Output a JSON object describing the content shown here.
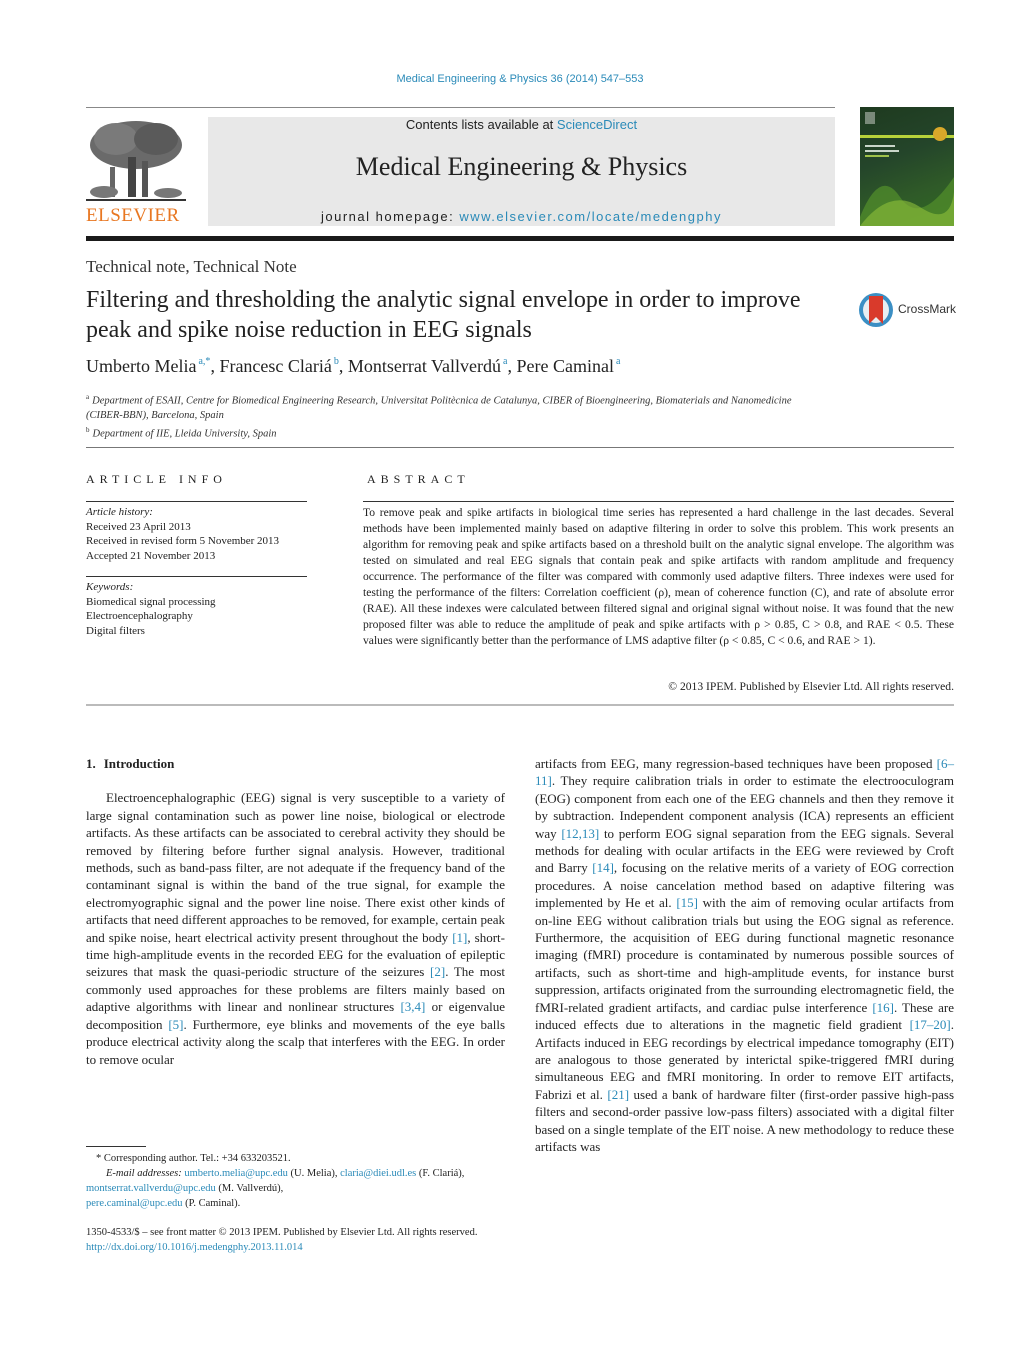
{
  "header": {
    "citation": "Medical Engineering & Physics 36 (2014) 547–553",
    "publisher_logo_text": "ELSEVIER",
    "contents_prefix": "Contents lists available at ",
    "contents_link": "ScienceDirect",
    "journal_name": "Medical Engineering & Physics",
    "homepage_prefix": "journal homepage: ",
    "homepage_link": "www.elsevier.com/locate/medengphy",
    "brand_color": "#e87722",
    "link_color": "#2a8ab8"
  },
  "article": {
    "type": "Technical note, Technical Note",
    "title": "Filtering and thresholding the analytic signal envelope in order to improve peak and spike noise reduction in EEG signals",
    "crossmark_label": "CrossMark",
    "authors": [
      {
        "name": "Umberto Melia",
        "sup": "a,*"
      },
      {
        "name": "Francesc Clariá",
        "sup": "b"
      },
      {
        "name": "Montserrat Vallverdú",
        "sup": "a"
      },
      {
        "name": "Pere Caminal",
        "sup": "a"
      }
    ],
    "affiliations": [
      {
        "label": "a",
        "text": "Department of ESAII, Centre for Biomedical Engineering Research, Universitat Politècnica de Catalunya, CIBER of Bioengineering, Biomaterials and Nanomedicine (CIBER-BBN), Barcelona, Spain"
      },
      {
        "label": "b",
        "text": "Department of IIE, Lleida University, Spain"
      }
    ]
  },
  "article_info": {
    "heading": "ARTICLE INFO",
    "history_label": "Article history:",
    "history": [
      "Received 23 April 2013",
      "Received in revised form 5 November 2013",
      "Accepted 21 November 2013"
    ],
    "keywords_label": "Keywords:",
    "keywords": [
      "Biomedical signal processing",
      "Electroencephalography",
      "Digital filters"
    ]
  },
  "abstract": {
    "heading": "ABSTRACT",
    "text": "To remove peak and spike artifacts in biological time series has represented a hard challenge in the last decades. Several methods have been implemented mainly based on adaptive filtering in order to solve this problem. This work presents an algorithm for removing peak and spike artifacts based on a threshold built on the analytic signal envelope. The algorithm was tested on simulated and real EEG signals that contain peak and spike artifacts with random amplitude and frequency occurrence. The performance of the filter was compared with commonly used adaptive filters. Three indexes were used for testing the performance of the filters: Correlation coefficient (ρ), mean of coherence function (C), and rate of absolute error (RAE). All these indexes were calculated between filtered signal and original signal without noise. It was found that the new proposed filter was able to reduce the amplitude of peak and spike artifacts with ρ > 0.85, C > 0.8, and RAE < 0.5. These values were significantly better than the performance of LMS adaptive filter (ρ < 0.85, C < 0.6, and RAE > 1).",
    "copyright": "© 2013 IPEM. Published by Elsevier Ltd. All rights reserved."
  },
  "body": {
    "section_number": "1.",
    "section_title": "Introduction",
    "left_column": [
      {
        "t": "Electroencephalographic (EEG) signal is very susceptible to a variety of large signal contamination such as power line noise, biological or electrode artifacts. As these artifacts can be associated to cerebral activity they should be removed by filtering before further signal analysis. However, traditional methods, such as band-pass filter, are not adequate if the frequency band of the contaminant signal is within the band of the true signal, for example the electromyographic signal and the power line noise. There exist other kinds of artifacts that need different approaches to be removed, for example, certain peak and spike noise, heart electrical activity present throughout the body "
      },
      {
        "ref": "[1]"
      },
      {
        "t": ", short-time high-amplitude events in the recorded EEG for the evaluation of epileptic seizures that mask the quasi-periodic structure of the seizures "
      },
      {
        "ref": "[2]"
      },
      {
        "t": ". The most commonly used approaches for these problems are filters mainly based on adaptive algorithms with linear and nonlinear structures "
      },
      {
        "ref": "[3,4]"
      },
      {
        "t": " or eigenvalue decomposition "
      },
      {
        "ref": "[5]"
      },
      {
        "t": ". Furthermore, eye blinks and movements of the eye balls produce electrical activity along the scalp that interferes with the EEG. In order to remove ocular"
      }
    ],
    "right_column": [
      {
        "t": "artifacts from EEG, many regression-based techniques have been proposed "
      },
      {
        "ref": "[6–11]"
      },
      {
        "t": ". They require calibration trials in order to estimate the electrooculogram (EOG) component from each one of the EEG channels and then they remove it by subtraction. Independent component analysis (ICA) represents an efficient way "
      },
      {
        "ref": "[12,13]"
      },
      {
        "t": " to perform EOG signal separation from the EEG signals. Several methods for dealing with ocular artifacts in the EEG were reviewed by Croft and Barry "
      },
      {
        "ref": "[14]"
      },
      {
        "t": ", focusing on the relative merits of a variety of EOG correction procedures. A noise cancelation method based on adaptive filtering was implemented by He et al. "
      },
      {
        "ref": "[15]"
      },
      {
        "t": " with the aim of removing ocular artifacts from on-line EEG without calibration trials but using the EOG signal as reference. Furthermore, the acquisition of EEG during functional magnetic resonance imaging (fMRI) procedure is contaminated by numerous possible sources of artifacts, such as short-time and high-amplitude events, for instance burst suppression, artifacts originated from the surrounding electromagnetic field, the fMRI-related gradient artifacts, and cardiac pulse interference "
      },
      {
        "ref": "[16]"
      },
      {
        "t": ". These are induced effects due to alterations in the magnetic field gradient "
      },
      {
        "ref": "[17–20]"
      },
      {
        "t": ". Artifacts induced in EEG recordings by electrical impedance tomography (EIT) are analogous to those generated by interictal spike-triggered fMRI during simultaneous EEG and fMRI monitoring. In order to remove EIT artifacts, Fabrizi et al. "
      },
      {
        "ref": "[21]"
      },
      {
        "t": " used a bank of hardware filter (first-order passive high-pass filters and second-order passive low-pass filters) associated with a digital filter based on a single template of the EIT noise. A new methodology to reduce these artifacts was"
      }
    ]
  },
  "footnotes": {
    "corresponding": "* Corresponding author. Tel.: +34 633203521.",
    "email_label": "E-mail addresses:",
    "emails": [
      {
        "email": "umberto.melia@upc.edu",
        "who": "(U. Melia),"
      },
      {
        "email": "claria@diei.udl.es",
        "who": "(F. Clariá),"
      },
      {
        "email": "montserrat.vallverdu@upc.edu",
        "who": "(M. Vallverdú),"
      },
      {
        "email": "pere.caminal@upc.edu",
        "who": "(P. Caminal)."
      }
    ],
    "front_matter": "1350-4533/$ – see front matter © 2013 IPEM. Published by Elsevier Ltd. All rights reserved.",
    "doi": "http://dx.doi.org/10.1016/j.medengphy.2013.11.014"
  }
}
